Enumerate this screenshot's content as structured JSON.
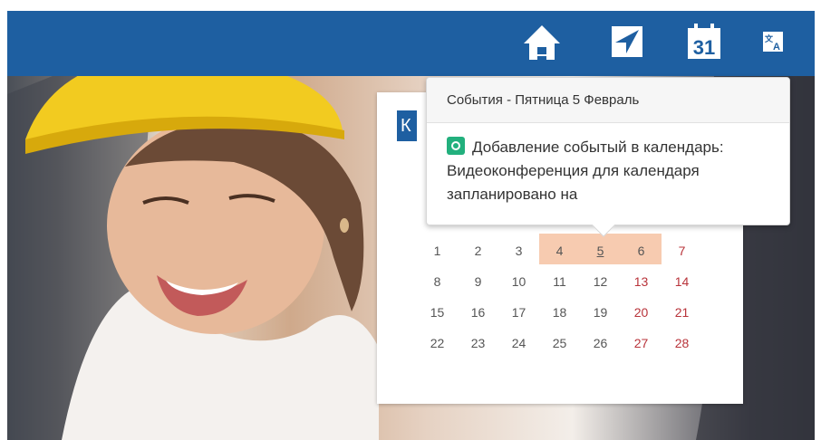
{
  "header": {
    "icons": [
      {
        "name": "home-icon"
      },
      {
        "name": "send-icon"
      },
      {
        "name": "calendar-icon",
        "label": "31"
      },
      {
        "name": "translate-icon"
      }
    ]
  },
  "calendar": {
    "title_visible": "К",
    "rows": [
      [
        "1",
        "2",
        "3",
        "4",
        "5",
        "6",
        "7"
      ],
      [
        "8",
        "9",
        "10",
        "11",
        "12",
        "13",
        "14"
      ],
      [
        "15",
        "16",
        "17",
        "18",
        "19",
        "20",
        "21"
      ],
      [
        "22",
        "23",
        "24",
        "25",
        "26",
        "27",
        "28"
      ]
    ],
    "highlighted": [
      "4",
      "5",
      "6"
    ],
    "today": "5",
    "weekend_color": "#b8333a",
    "highlight_color": "#f7cbb0"
  },
  "popover": {
    "header": "События - Пятница 5 Февраль",
    "event_text": "Добавление событый в календарь: Видеоконференция для календаря запланировано на"
  },
  "colors": {
    "brand": "#1e5fa1"
  }
}
